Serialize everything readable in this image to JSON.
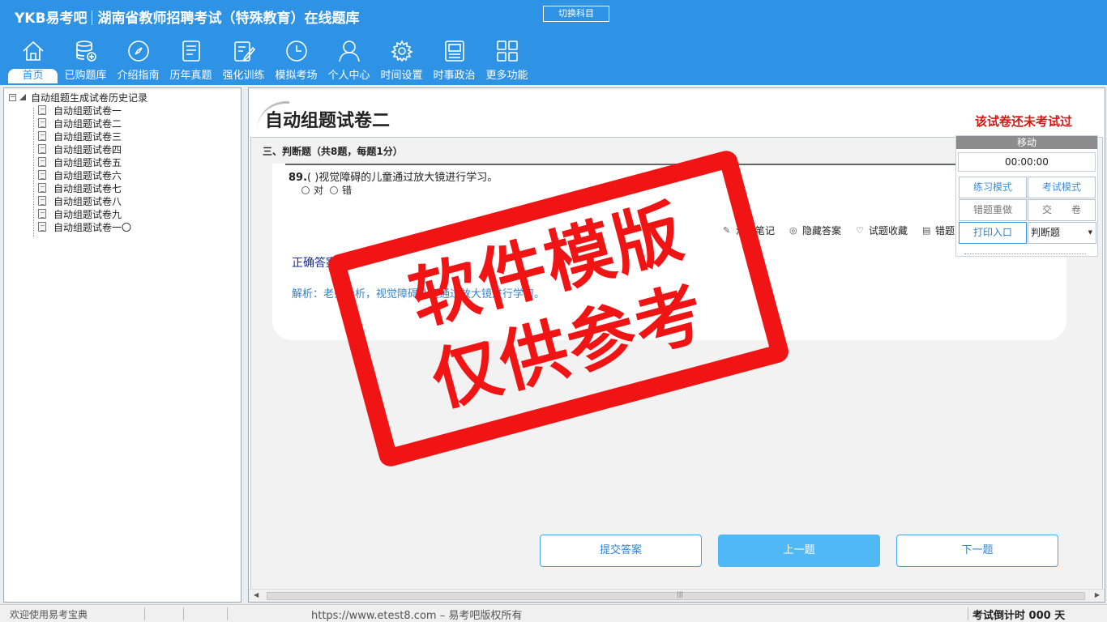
{
  "header": {
    "logo": "YKB易考吧",
    "title": "湖南省教师招聘考试（特殊教育）在线题库",
    "switch_label": "切换科目"
  },
  "nav": [
    {
      "label": "首页",
      "icon": "home-icon"
    },
    {
      "label": "已购题库",
      "icon": "database-icon"
    },
    {
      "label": "介绍指南",
      "icon": "compass-icon"
    },
    {
      "label": "历年真题",
      "icon": "list-icon"
    },
    {
      "label": "强化训练",
      "icon": "edit-icon"
    },
    {
      "label": "模拟考场",
      "icon": "clock-icon"
    },
    {
      "label": "个人中心",
      "icon": "user-icon"
    },
    {
      "label": "时间设置",
      "icon": "gear-icon"
    },
    {
      "label": "时事政治",
      "icon": "news-icon"
    },
    {
      "label": "更多功能",
      "icon": "grid-icon"
    }
  ],
  "tree": {
    "root": "自动组题生成试卷历史记录",
    "items": [
      "自动组题试卷一",
      "自动组题试卷二",
      "自动组题试卷三",
      "自动组题试卷四",
      "自动组题试卷五",
      "自动组题试卷六",
      "自动组题试卷七",
      "自动组题试卷八",
      "自动组题试卷九",
      "自动组题试卷一〇"
    ]
  },
  "paper": {
    "title": "自动组题试卷二",
    "status": "该试卷还未考试过",
    "section": "三、判断题（共8题，每题1分）"
  },
  "question": {
    "number": "89.",
    "text": "( )视觉障碍的儿童通过放大镜进行学习。",
    "options": [
      "对",
      "错"
    ],
    "answer_label": "正确答案",
    "analysis": "解析：老师分析，视觉障碍儿童通过放大镜进行学习。"
  },
  "tools": [
    {
      "label": "添加笔记",
      "icon": "pencil-icon"
    },
    {
      "label": "隐藏答案",
      "icon": "eye-icon"
    },
    {
      "label": "试题收藏",
      "icon": "heart-icon"
    },
    {
      "label": "错题",
      "icon": "book-icon"
    }
  ],
  "buttons": {
    "submit": "提交答案",
    "prev": "上一题",
    "next": "下一题"
  },
  "control": {
    "move": "移动",
    "timer": "00:00:00",
    "practice": "练习模式",
    "exam": "考试模式",
    "redo": "错题重做",
    "hand_in": "交　　卷",
    "print": "打印入口",
    "type_select": "判断题"
  },
  "watermark": {
    "line1": "软件模版",
    "line2": "仅供参考"
  },
  "statusbar": {
    "welcome": "欢迎使用易考宝典",
    "url": "https://www.etest8.com – 易考吧版权所有",
    "countdown": "考试倒计时 000 天"
  },
  "colors": {
    "header": "#2f93e5",
    "accent": "#50b9f5",
    "stamp": "#f01414",
    "status_red": "#d41616"
  }
}
